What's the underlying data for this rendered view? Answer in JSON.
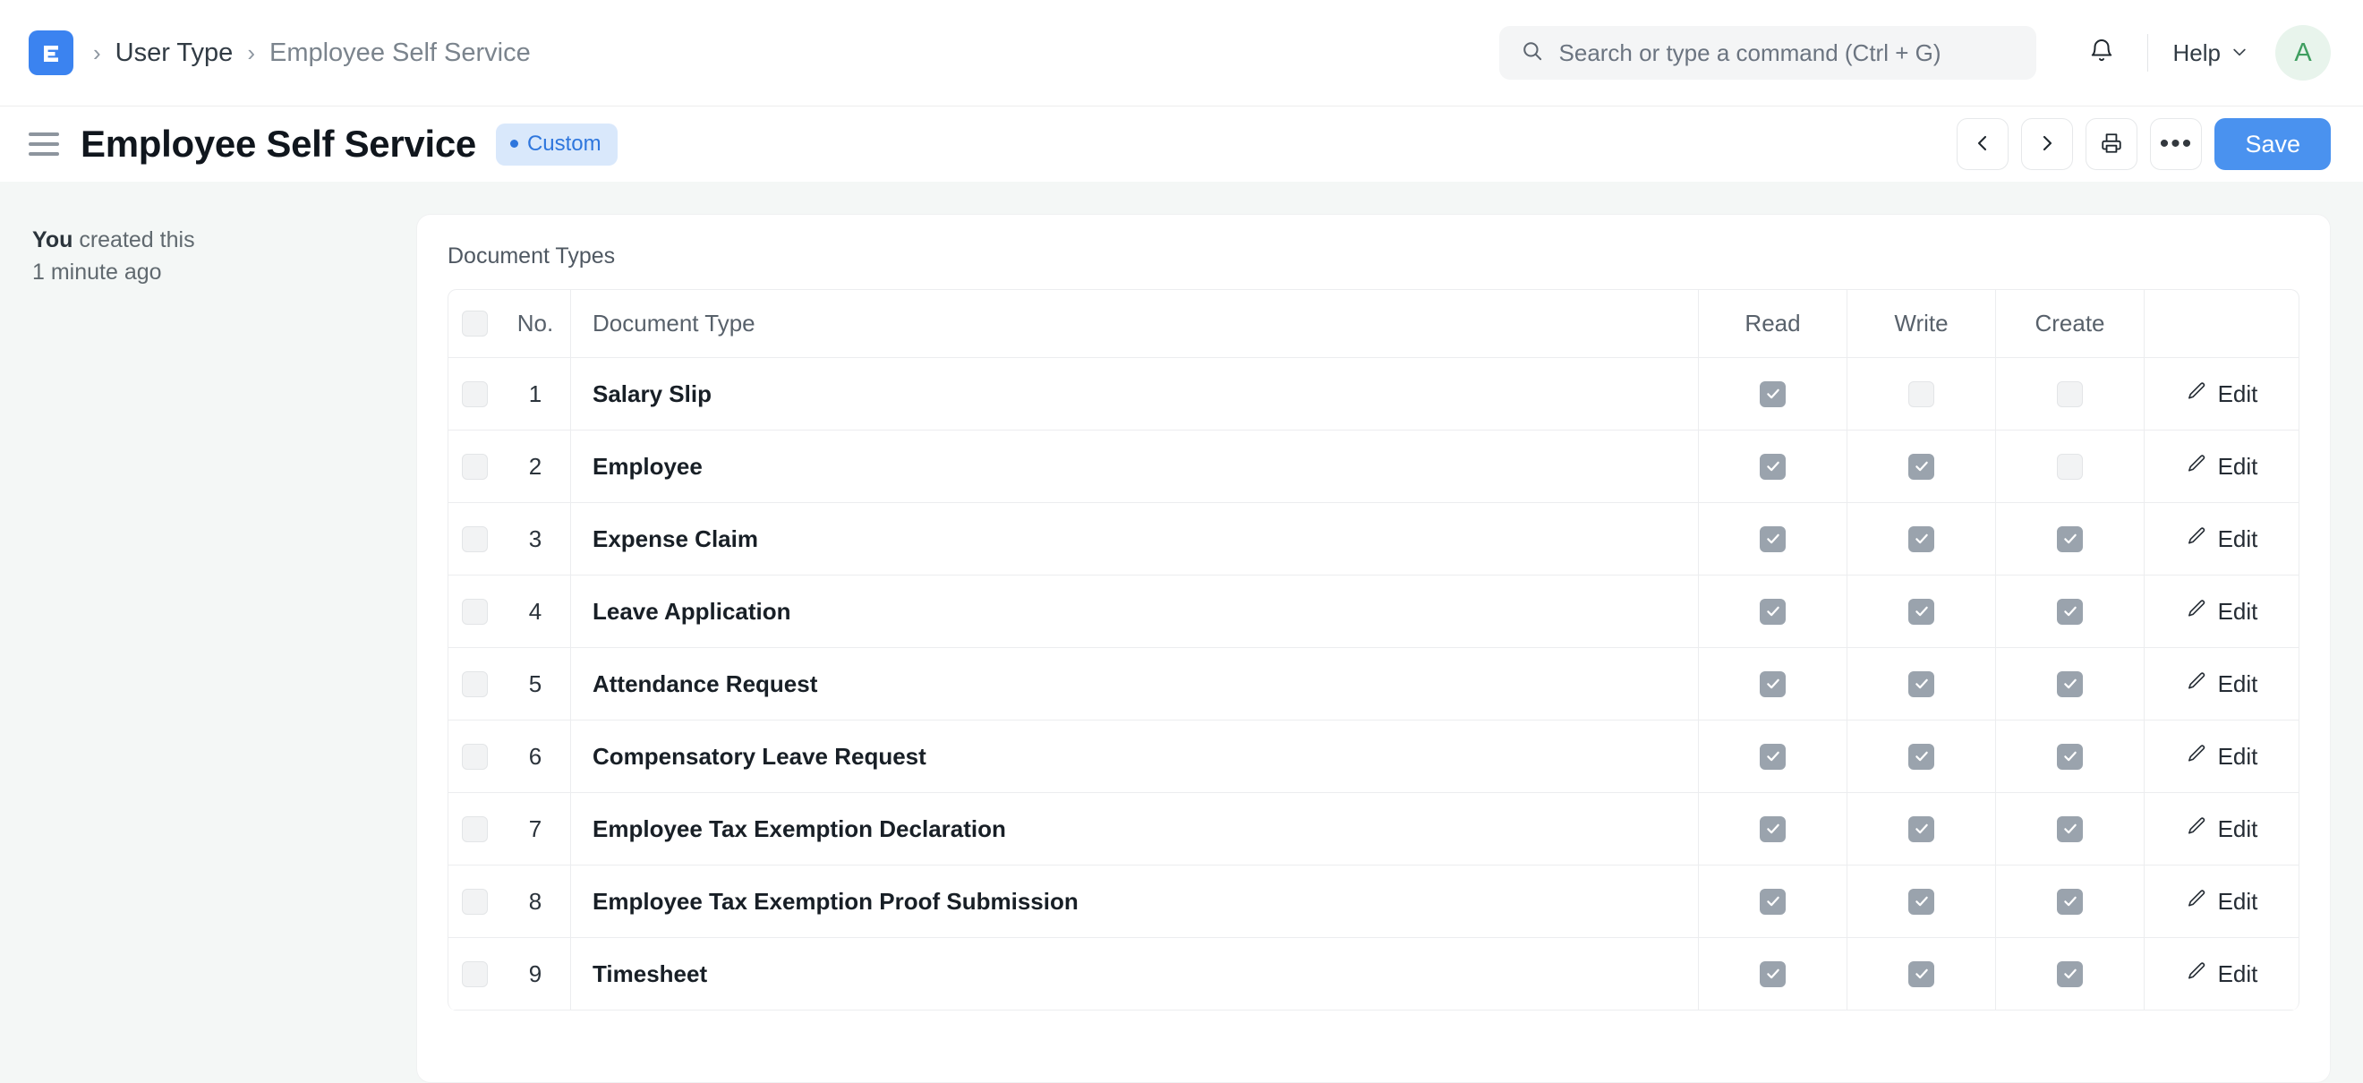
{
  "navbar": {
    "logo_icon": "erpnext-logo-icon",
    "breadcrumb": {
      "separator": "›",
      "parent": "User Type",
      "current": "Employee Self Service"
    },
    "search": {
      "icon": "search-icon",
      "placeholder": "Search or type a command (Ctrl + G)",
      "value": ""
    },
    "notifications_icon": "bell-icon",
    "help": {
      "label": "Help",
      "icon": "chevron-down-icon"
    },
    "avatar": {
      "initial": "A",
      "bg": "#e8f4ec",
      "color": "#3f9e60"
    }
  },
  "page_head": {
    "menu_icon": "hamburger-icon",
    "title": "Employee Self Service",
    "badge": {
      "label": "Custom",
      "color": "#2e76dd",
      "bg": "#d9e8fb"
    },
    "actions": {
      "prev_icon": "chevron-left-icon",
      "next_icon": "chevron-right-icon",
      "print_icon": "printer-icon",
      "more_icon": "ellipsis-icon",
      "more_label": "•••",
      "save_label": "Save",
      "save_color": "#4a92ef"
    }
  },
  "sidebar": {
    "created_by": "You",
    "created_text": "created this",
    "created_time": "1 minute ago"
  },
  "main": {
    "section_label": "Document Types",
    "table": {
      "columns": {
        "select": "",
        "no": "No.",
        "document_type": "Document Type",
        "read": "Read",
        "write": "Write",
        "create": "Create",
        "action": ""
      },
      "edit_label": "Edit",
      "edit_icon": "pencil-icon",
      "header_select_checked": false,
      "rows": [
        {
          "no": "1",
          "selected": false,
          "document_type": "Salary Slip",
          "read": true,
          "write": false,
          "create": false
        },
        {
          "no": "2",
          "selected": false,
          "document_type": "Employee",
          "read": true,
          "write": true,
          "create": false
        },
        {
          "no": "3",
          "selected": false,
          "document_type": "Expense Claim",
          "read": true,
          "write": true,
          "create": true
        },
        {
          "no": "4",
          "selected": false,
          "document_type": "Leave Application",
          "read": true,
          "write": true,
          "create": true
        },
        {
          "no": "5",
          "selected": false,
          "document_type": "Attendance Request",
          "read": true,
          "write": true,
          "create": true
        },
        {
          "no": "6",
          "selected": false,
          "document_type": "Compensatory Leave Request",
          "read": true,
          "write": true,
          "create": true
        },
        {
          "no": "7",
          "selected": false,
          "document_type": "Employee Tax Exemption Declaration",
          "read": true,
          "write": true,
          "create": true
        },
        {
          "no": "8",
          "selected": false,
          "document_type": "Employee Tax Exemption Proof Submission",
          "read": true,
          "write": true,
          "create": true
        },
        {
          "no": "9",
          "selected": false,
          "document_type": "Timesheet",
          "read": true,
          "write": true,
          "create": true
        }
      ]
    }
  }
}
